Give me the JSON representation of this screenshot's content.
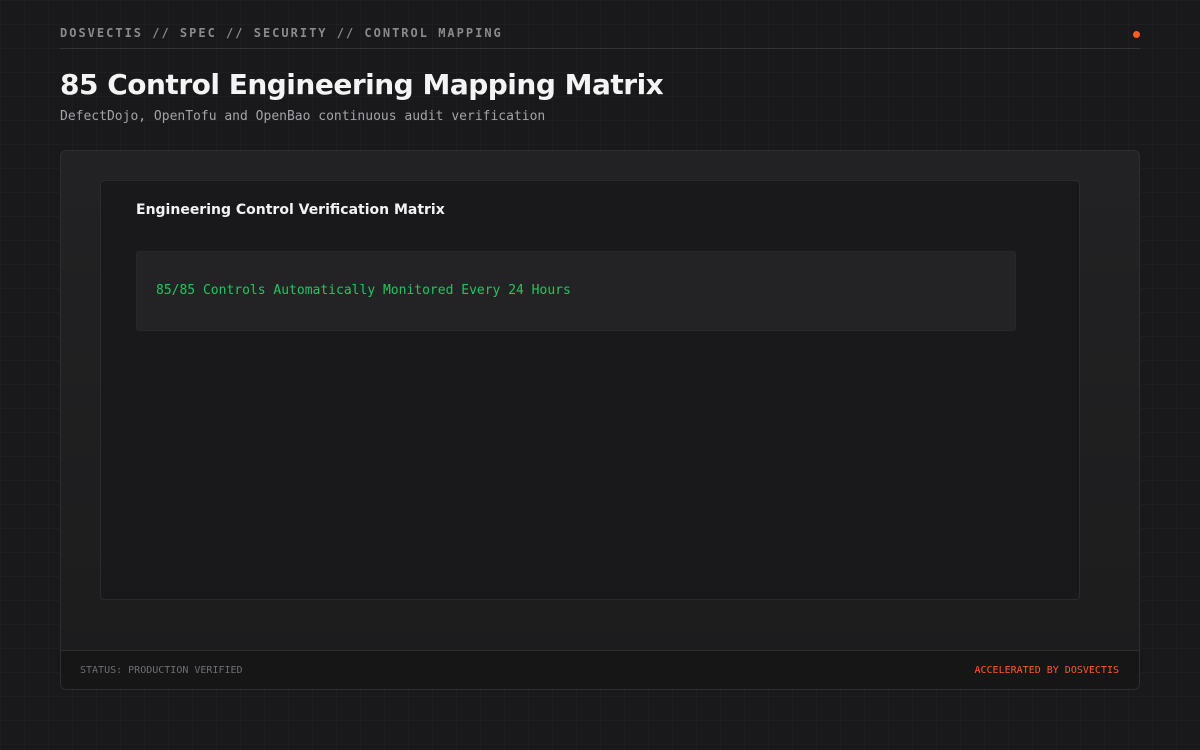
{
  "header": {
    "breadcrumb": "DOSVECTIS // SPEC // SECURITY // CONTROL MAPPING",
    "title": "85 Control Engineering Mapping Matrix",
    "subtitle": "DefectDojo, OpenTofu and OpenBao continuous audit verification"
  },
  "panel": {
    "title": "Engineering Control Verification Matrix",
    "metric": "85/85 Controls Automatically Monitored Every 24 Hours"
  },
  "footer": {
    "status": "STATUS: PRODUCTION VERIFIED",
    "credit": "ACCELERATED BY DOSVECTIS"
  },
  "colors": {
    "background": "#19191b",
    "accent": "#ff5a1f",
    "success": "#22c55e",
    "text_primary": "#f4f4f5",
    "text_muted": "#8a8a8e"
  }
}
